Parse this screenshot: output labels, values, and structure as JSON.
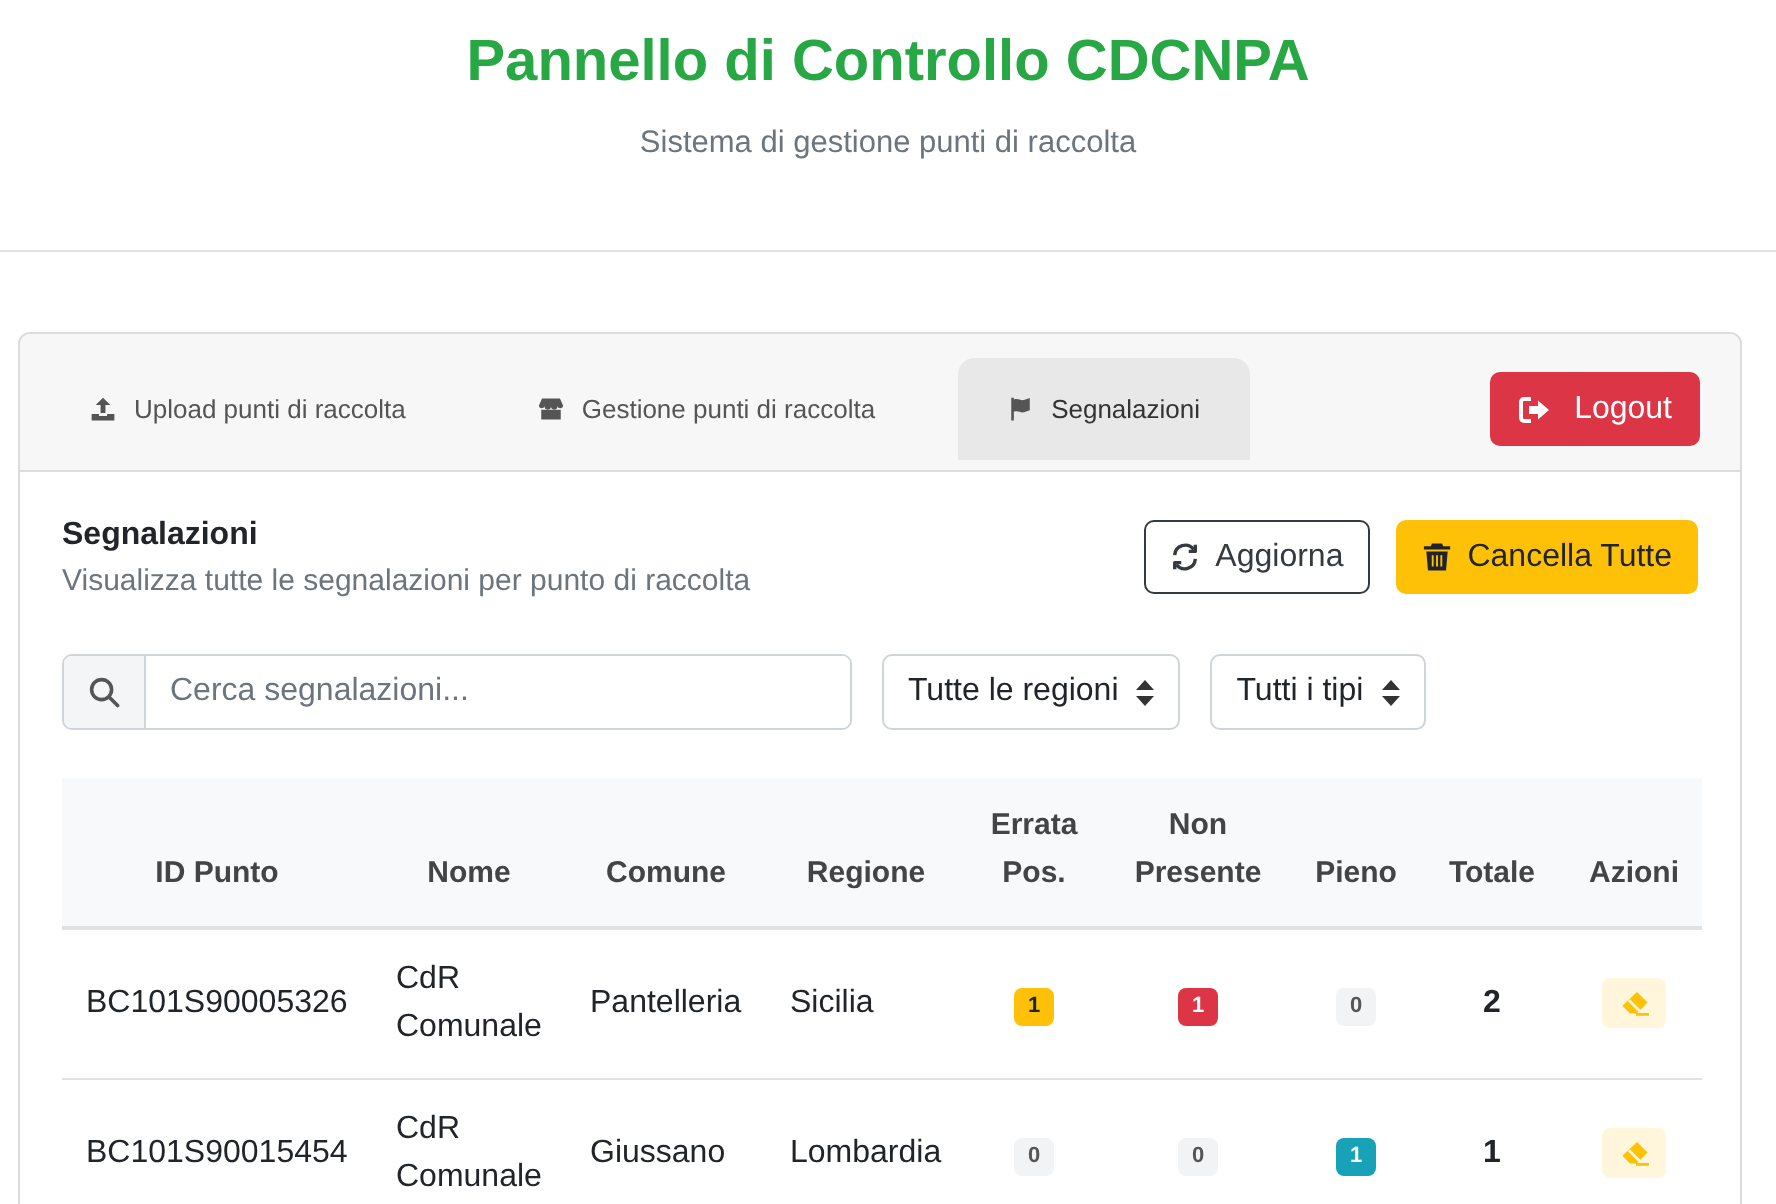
{
  "header": {
    "title": "Pannello di Controllo CDCNPA",
    "subtitle": "Sistema di gestione punti di raccolta"
  },
  "tabs": [
    {
      "label": "Upload punti di raccolta",
      "selected": false
    },
    {
      "label": "Gestione punti di raccolta",
      "selected": false
    },
    {
      "label": "Segnalazioni",
      "selected": true
    }
  ],
  "logout_button": {
    "label": "Logout"
  },
  "section": {
    "title": "Segnalazioni",
    "description": "Visualizza tutte le segnalazioni per punto di raccolta"
  },
  "buttons": [
    {
      "label": "Aggiorna",
      "kind": "outline"
    },
    {
      "label": "Cancella Tutte",
      "kind": "warning"
    }
  ],
  "filters": {
    "search": {
      "placeholder": "Cerca segnalazioni..."
    },
    "selects": [
      "Tutte le regioni",
      "Tutti i tipi"
    ]
  },
  "table": {
    "columns": [
      "ID Punto",
      "Nome",
      "Comune",
      "Regione",
      "Errata Pos.",
      "Non Presente",
      "Pieno",
      "Totale",
      "Azioni"
    ],
    "rows": [
      {
        "id": "BC101S90005326",
        "name": "CdR Comunale",
        "comune": "Pantelleria",
        "regione": "Sicilia",
        "counts": [
          {
            "value": "1",
            "color": "#ffc107"
          },
          {
            "value": "1",
            "color": "#dc3545"
          },
          {
            "value": "0",
            "color": "#f1f3f5"
          }
        ],
        "total": "2"
      },
      {
        "id": "BC101S90015454",
        "name": "CdR Comunale",
        "comune": "Giussano",
        "regione": "Lombardia",
        "counts": [
          {
            "value": "0",
            "color": "#f1f3f5"
          },
          {
            "value": "0",
            "color": "#f1f3f5"
          },
          {
            "value": "1",
            "color": "#17a2b8"
          }
        ],
        "total": "1"
      }
    ]
  }
}
